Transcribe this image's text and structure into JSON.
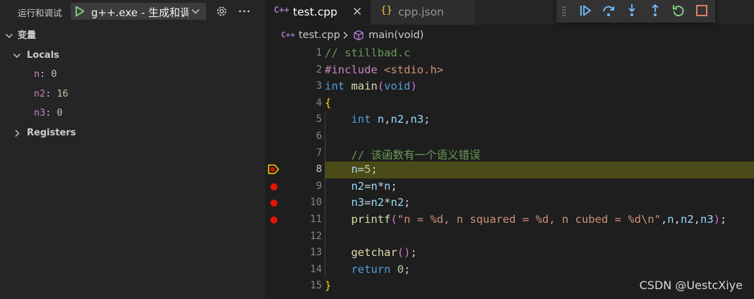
{
  "sidebar": {
    "run_title": "运行和调试",
    "launch_config": "g++.exe - 生成和调试",
    "variables_section": "变量",
    "locals_label": "Locals",
    "registers_label": "Registers",
    "locals": [
      {
        "name": "n",
        "value": "0"
      },
      {
        "name": "n2",
        "value": "16"
      },
      {
        "name": "n3",
        "value": "0"
      }
    ]
  },
  "tabs": [
    {
      "icon": "C++",
      "label": "test.cpp",
      "active": true
    },
    {
      "icon": "{}",
      "label": "cpp.json",
      "active": false
    }
  ],
  "breadcrumb": {
    "file_icon": "C++",
    "file": "test.cpp",
    "symbol": "main(void)"
  },
  "editor": {
    "current_line": 8,
    "breakpoint_lines": [
      9,
      10,
      11
    ],
    "lines": [
      {
        "n": "1",
        "text": "// stillbad.c"
      },
      {
        "n": "2",
        "text": "#include <stdio.h>"
      },
      {
        "n": "3",
        "text": "int main(void)"
      },
      {
        "n": "4",
        "text": "{"
      },
      {
        "n": "5",
        "text": "    int n,n2,n3;"
      },
      {
        "n": "6",
        "text": ""
      },
      {
        "n": "7",
        "text": "    // 该函数有一个语义错误"
      },
      {
        "n": "8",
        "text": "    n=5;"
      },
      {
        "n": "9",
        "text": "    n2=n*n;"
      },
      {
        "n": "10",
        "text": "    n3=n2*n2;"
      },
      {
        "n": "11",
        "text": "    printf(\"n = %d, n squared = %d, n cubed = %d\\n\",n,n2,n3);"
      },
      {
        "n": "12",
        "text": ""
      },
      {
        "n": "13",
        "text": "    getchar();"
      },
      {
        "n": "14",
        "text": "    return 0;"
      },
      {
        "n": "15",
        "text": "}"
      }
    ]
  },
  "debug_toolbar": [
    "continue-icon",
    "step-over-icon",
    "step-into-icon",
    "step-out-icon",
    "restart-icon",
    "stop-icon"
  ],
  "colors": {
    "accent_blue": "#75beff",
    "restart_green": "#89d185",
    "stop_red": "#f48771",
    "breakpoint_red": "#e51400",
    "current_line_bg": "#4b4b18"
  },
  "watermark": "CSDN @UestcXiye"
}
